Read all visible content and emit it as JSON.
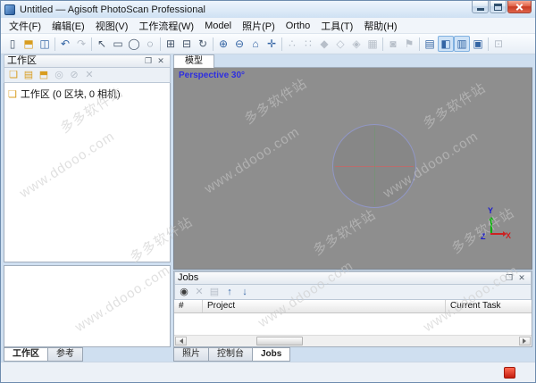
{
  "window": {
    "title": "Untitled — Agisoft PhotoScan Professional",
    "controls": [
      "minimize",
      "maximize",
      "close"
    ]
  },
  "menu": {
    "items": [
      "文件(F)",
      "编辑(E)",
      "视图(V)",
      "工作流程(W)",
      "Model",
      "照片(P)",
      "Ortho",
      "工具(T)",
      "帮助(H)"
    ]
  },
  "toolbar": {
    "buttons": [
      {
        "name": "new-project",
        "glyph": "▯"
      },
      {
        "name": "open-project",
        "glyph": "⬒"
      },
      {
        "name": "save-project",
        "glyph": "◫"
      },
      {
        "name": "undo",
        "glyph": "↶"
      },
      {
        "name": "redo",
        "glyph": "↷"
      },
      {
        "name": "navigation-tool",
        "glyph": "↖"
      },
      {
        "name": "rectangle-selection",
        "glyph": "▭"
      },
      {
        "name": "circle-selection",
        "glyph": "◯"
      },
      {
        "name": "freeform-selection",
        "glyph": "◌"
      },
      {
        "name": "move-region",
        "glyph": "⊞"
      },
      {
        "name": "resize-region",
        "glyph": "⊟"
      },
      {
        "name": "rotate-region",
        "glyph": "↻"
      },
      {
        "name": "zoom-in",
        "glyph": "⊕"
      },
      {
        "name": "zoom-out",
        "glyph": "⊖"
      },
      {
        "name": "reset-view",
        "glyph": "⌂"
      },
      {
        "name": "center-view",
        "glyph": "✛"
      },
      {
        "name": "show-point-cloud",
        "glyph": "∴"
      },
      {
        "name": "show-dense-cloud",
        "glyph": "∷"
      },
      {
        "name": "show-mesh-shaded",
        "glyph": "◆"
      },
      {
        "name": "show-mesh-solid",
        "glyph": "◇"
      },
      {
        "name": "show-mesh-wireframe",
        "glyph": "◈"
      },
      {
        "name": "show-mesh-textured",
        "glyph": "▦"
      },
      {
        "name": "show-cameras",
        "glyph": "◙"
      },
      {
        "name": "show-markers",
        "glyph": "⚑"
      },
      {
        "name": "photos-pane-toggle",
        "glyph": "▤"
      },
      {
        "name": "workspace-pane-toggle",
        "glyph": "◧"
      },
      {
        "name": "console-pane-toggle",
        "glyph": "▥"
      },
      {
        "name": "jobs-pane-toggle",
        "glyph": "▣"
      },
      {
        "name": "capture-view",
        "glyph": "⊡"
      }
    ]
  },
  "dock": {
    "float_icon": "❐",
    "close_icon": "✕"
  },
  "workspace_panel": {
    "title": "工作区",
    "toolbar": [
      {
        "name": "add-chunk",
        "glyph": "❏"
      },
      {
        "name": "add-photos",
        "glyph": "▤"
      },
      {
        "name": "add-folder",
        "glyph": "⬒"
      },
      {
        "name": "enable-item",
        "glyph": "◎"
      },
      {
        "name": "disable-item",
        "glyph": "⊘"
      },
      {
        "name": "remove-item",
        "glyph": "✕"
      }
    ],
    "tree_root": {
      "icon": "❏",
      "label": "工作区 (0 区块, 0 相机)"
    }
  },
  "left_tabs": [
    {
      "label": "工作区",
      "active": true
    },
    {
      "label": "参考",
      "active": false
    }
  ],
  "viewport": {
    "tab": "模型",
    "perspective_label": "Perspective 30°",
    "background_color": "#8e8e8e",
    "perspective_color": "#2f2fe0",
    "axis": {
      "x_label": "X",
      "y_label": "Y",
      "z_label": "Z",
      "x_color": "#cc2222",
      "y_color": "#1a1acc",
      "z_color": "#1a1acc",
      "y_axis_color": "#00b000",
      "x_axis_color": "#cc2222"
    }
  },
  "jobs_panel": {
    "title": "Jobs",
    "toolbar": [
      {
        "name": "start-job",
        "glyph": "◉"
      },
      {
        "name": "remove-job",
        "glyph": "✕"
      },
      {
        "name": "export-jobs",
        "glyph": "▤"
      },
      {
        "name": "move-job-up",
        "glyph": "↑"
      },
      {
        "name": "move-job-down",
        "glyph": "↓"
      }
    ],
    "columns": [
      "#",
      "Project",
      "Current Task"
    ],
    "rows": []
  },
  "right_tabs": [
    {
      "label": "照片",
      "active": false
    },
    {
      "label": "控制台",
      "active": false
    },
    {
      "label": "Jobs",
      "active": true
    }
  ],
  "watermark": {
    "texts": [
      "多多软件站",
      "www.ddooo.com"
    ],
    "color": "#cacaca"
  }
}
